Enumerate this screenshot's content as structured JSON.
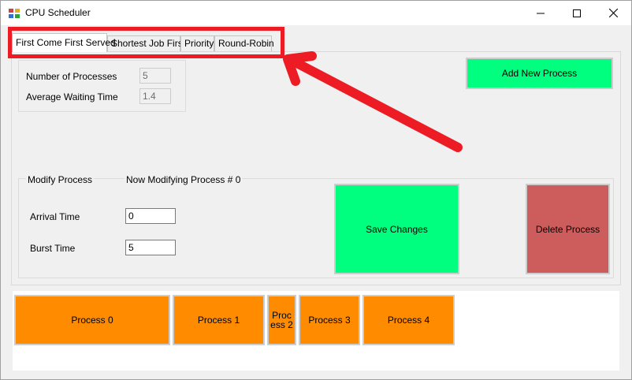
{
  "window": {
    "title": "CPU Scheduler"
  },
  "tabs": [
    {
      "label": "First Come First Served"
    },
    {
      "label": "Shortest Job First"
    },
    {
      "label": "Priority"
    },
    {
      "label": "Round-Robin"
    }
  ],
  "stats": {
    "num_processes_label": "Number of Processes",
    "num_processes_value": "5",
    "avg_wait_label": "Average Waiting Time",
    "avg_wait_value": "1.4"
  },
  "add_button_label": "Add New Process",
  "modify": {
    "title": "Modify Process",
    "now_modifying": "Now Modifying Process # 0",
    "arrival_label": "Arrival Time",
    "arrival_value": "0",
    "burst_label": "Burst Time",
    "burst_value": "5"
  },
  "save_button_label": "Save Changes",
  "delete_button_label": "Delete Process",
  "timeline": [
    {
      "label": "Process 0"
    },
    {
      "label": "Process 1"
    },
    {
      "label": "Proc ess 2"
    },
    {
      "label": "Process 3"
    },
    {
      "label": "Process 4"
    }
  ],
  "colors": {
    "green_button": "#00ff7f",
    "red_button": "#cd5c5c",
    "process_block": "#ff8c00",
    "annotation": "#ed1c24"
  }
}
